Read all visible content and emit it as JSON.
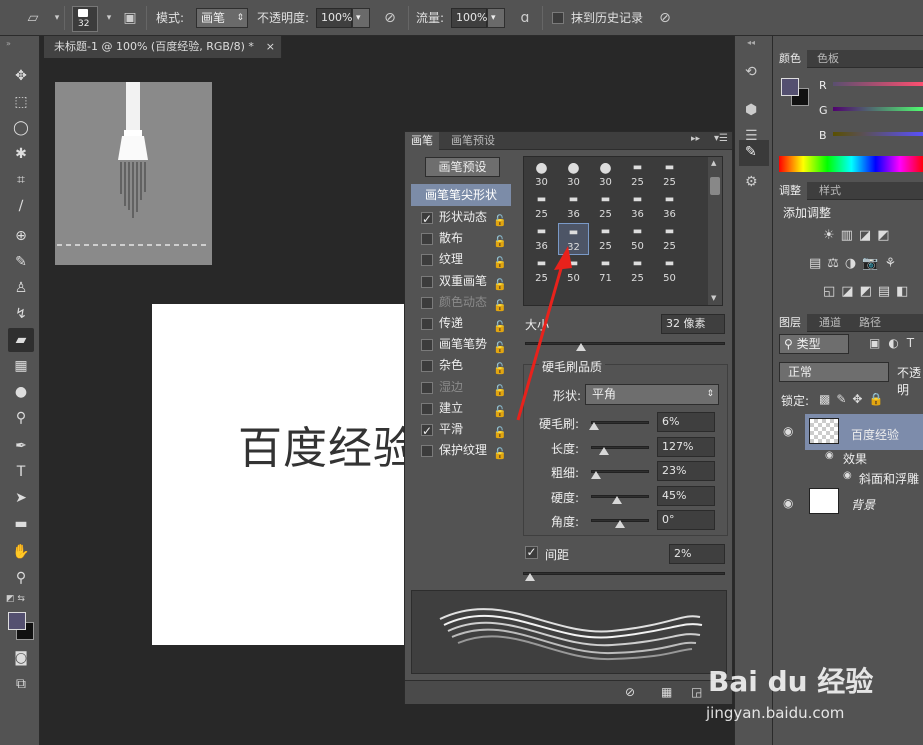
{
  "options_bar": {
    "brush_size": "32",
    "mode_label": "模式:",
    "mode_value": "画笔",
    "opacity_label": "不透明度:",
    "opacity_value": "100%",
    "flow_label": "流量:",
    "flow_value": "100%",
    "erase_history_label": "抹到历史记录"
  },
  "document": {
    "tab_title": "未标题-1 @ 100% (百度经验, RGB/8) *",
    "tab_close": "×",
    "canvas_text": "百度经验"
  },
  "brush_panel": {
    "tab_brush": "画笔",
    "tab_presets": "画笔预设",
    "preset_button": "画笔预设",
    "tip_shape_header": "画笔笔尖形状",
    "options": [
      {
        "label": "形状动态",
        "checked": true,
        "disabled": false
      },
      {
        "label": "散布",
        "checked": false,
        "disabled": false
      },
      {
        "label": "纹理",
        "checked": false,
        "disabled": false
      },
      {
        "label": "双重画笔",
        "checked": false,
        "disabled": false
      },
      {
        "label": "颜色动态",
        "checked": false,
        "disabled": true
      },
      {
        "label": "传递",
        "checked": false,
        "disabled": false
      },
      {
        "label": "画笔笔势",
        "checked": false,
        "disabled": false
      },
      {
        "label": "杂色",
        "checked": false,
        "disabled": false
      },
      {
        "label": "湿边",
        "checked": false,
        "disabled": true
      },
      {
        "label": "建立",
        "checked": false,
        "disabled": false
      },
      {
        "label": "平滑",
        "checked": true,
        "disabled": false
      },
      {
        "label": "保护纹理",
        "checked": false,
        "disabled": false
      }
    ],
    "tip_sizes": [
      [
        "30",
        "30",
        "30",
        "25",
        "25"
      ],
      [
        "25",
        "36",
        "25",
        "36",
        "36"
      ],
      [
        "36",
        "32",
        "25",
        "50",
        "25"
      ],
      [
        "25",
        "50",
        "71",
        "25",
        "50"
      ]
    ],
    "size_label": "大小",
    "size_value": "32 像素",
    "size_fraction": 0.28,
    "bristle_header": "硬毛刷品质",
    "shape_label": "形状:",
    "shape_value": "平角",
    "bristles": [
      {
        "label": "硬毛刷:",
        "value": "6%",
        "level": 0.06
      },
      {
        "label": "长度:",
        "value": "127%",
        "level": 0.22
      },
      {
        "label": "粗细:",
        "value": "23%",
        "level": 0.08
      },
      {
        "label": "硬度:",
        "value": "45%",
        "level": 0.45
      },
      {
        "label": "角度:",
        "value": "0°",
        "level": 0.5
      }
    ],
    "spacing_label": "间距",
    "spacing_value": "2%",
    "spacing_fraction": 0.01
  },
  "right_panel": {
    "color_tab": "颜色",
    "swatches_tab": "色板",
    "channel_r": "R",
    "channel_g": "G",
    "channel_b": "B",
    "adjust_tab": "调整",
    "styles_tab": "样式",
    "add_adjust": "添加调整",
    "layers_tab": "图层",
    "channels_tab": "通道",
    "paths_tab": "路径",
    "kind_filter": "类型",
    "blend_mode": "正常",
    "opacity_short": "不透明",
    "lock_label": "锁定:",
    "layer1_name": "百度经验",
    "effects_label": "效果",
    "effect_name": "斜面和浮雕",
    "layer_bg_name": "背景"
  },
  "watermark": {
    "brand": "Bai du 经验",
    "url": "jingyan.baidu.com"
  }
}
